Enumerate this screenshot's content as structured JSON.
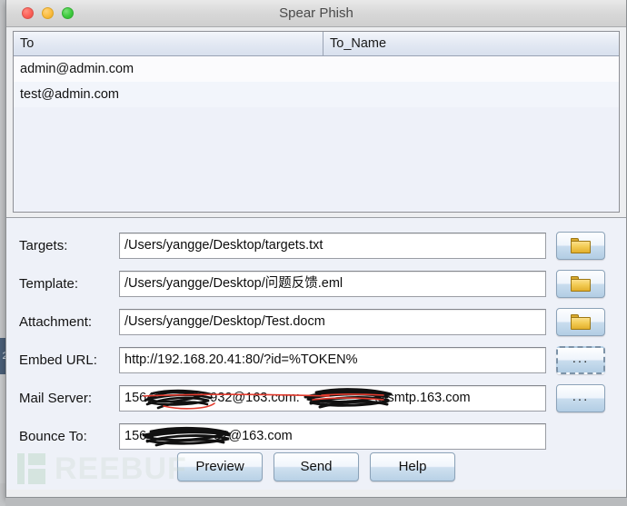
{
  "window": {
    "title": "Spear Phish",
    "traffic_lights": [
      {
        "name": "close",
        "color": "#fb6058"
      },
      {
        "name": "minimize",
        "color": "#fbbd40"
      },
      {
        "name": "maximize",
        "color": "#3ecb3e"
      }
    ]
  },
  "background": {
    "peek_label": "2"
  },
  "table": {
    "columns": [
      "To",
      "To_Name"
    ],
    "rows": [
      {
        "to": "admin@admin.com",
        "to_name": ""
      },
      {
        "to": "test@admin.com",
        "to_name": ""
      }
    ]
  },
  "form": {
    "rows": [
      {
        "label": "Targets:",
        "value": "/Users/yangge/Desktop/targets.txt",
        "button": {
          "icon": "folder-icon",
          "label": "",
          "focused": false
        }
      },
      {
        "label": "Template:",
        "value": "/Users/yangge/Desktop/问题反馈.eml",
        "button": {
          "icon": "folder-icon",
          "label": "",
          "focused": false
        }
      },
      {
        "label": "Attachment:",
        "value": "/Users/yangge/Desktop/Test.docm",
        "button": {
          "icon": "folder-icon",
          "label": "",
          "focused": false
        }
      },
      {
        "label": "Embed URL:",
        "value": "http://192.168.20.41:80/?id=%TOKEN%",
        "button": {
          "icon": "ellipsis-icon",
          "label": "...",
          "focused": true
        }
      },
      {
        "label": "Mail Server:",
        "value": "1564████932@163.com:█████@smtp.163.com",
        "value_visible_left": "1564",
        "value_visible_mid": "932@163.com:",
        "value_visible_right": "@smtp.163.com",
        "redacted": true,
        "button": {
          "icon": "ellipsis-icon",
          "label": "...",
          "focused": false
        }
      },
      {
        "label": "Bounce To:",
        "value": "1564████32@163.com",
        "value_visible_left": "1564",
        "value_visible_right": "32@163.com",
        "redacted": true,
        "button": null
      }
    ]
  },
  "actions": [
    {
      "label": "Preview",
      "name": "preview-button"
    },
    {
      "label": "Send",
      "name": "send-button"
    },
    {
      "label": "Help",
      "name": "help-button"
    }
  ],
  "watermark": {
    "text": "REEBUF",
    "full": "FREEBUF",
    "color": "#9dc7a6"
  }
}
